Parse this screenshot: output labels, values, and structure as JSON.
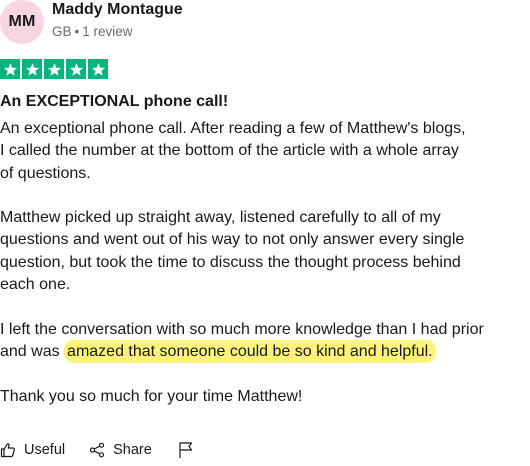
{
  "reviewer": {
    "initials": "MM",
    "name": "Maddy Montague",
    "country": "GB",
    "separator": "•",
    "review_count": "1 review",
    "avatar_color": "#f8d5e3"
  },
  "rating": {
    "stars": 5,
    "max_stars": 5,
    "star_color": "#00b67a"
  },
  "review": {
    "title": "An EXCEPTIONAL phone call!",
    "paragraph1": {
      "line1": "An exceptional phone call. After reading a few of Matthew's blogs,",
      "line2": "I called the number at the bottom of the article with a whole array",
      "line3": "of questions."
    },
    "paragraph2": {
      "line1": "Matthew picked up straight away, listened carefully to all of my",
      "line2": "questions and went out of his way to not only answer every single",
      "line3": "question, but took the time to discuss the thought process behind",
      "line4": "each one."
    },
    "paragraph3": {
      "line1": "I left the conversation with so much more knowledge than I had prior",
      "line2_prefix": "and was ",
      "line2_highlight": "amazed that someone could be so kind and helpful."
    },
    "paragraph4": "Thank you so much for your time Matthew!",
    "highlight_color": "#fdf27a"
  },
  "actions": {
    "useful_label": "Useful",
    "share_label": "Share",
    "icons": {
      "useful": "thumbs-up-icon",
      "share": "share-icon",
      "report": "flag-icon"
    }
  }
}
